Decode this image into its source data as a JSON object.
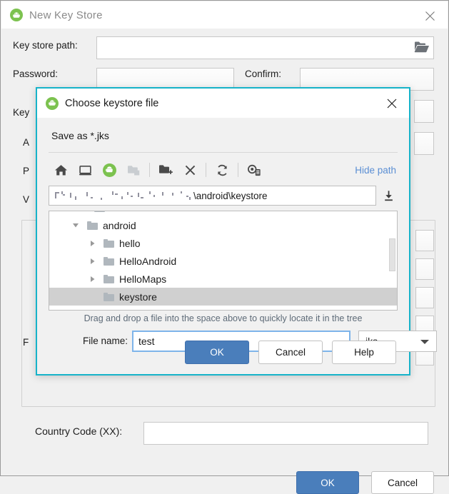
{
  "outer_window": {
    "title": "New Key Store",
    "icon": "android-studio-icon",
    "close_icon": "close-icon",
    "fields": [
      {
        "label": "Key store path:",
        "value": "",
        "browse_icon": "folder-open-icon"
      },
      {
        "label": "Password:",
        "value": ""
      },
      {
        "label": "Confirm:",
        "value": ""
      },
      {
        "label": "Key",
        "value": ""
      },
      {
        "label": "A",
        "value": ""
      },
      {
        "label": "P",
        "value": ""
      },
      {
        "label": "V",
        "value": ""
      },
      {
        "label": "F",
        "value": ""
      },
      {
        "label": "Country Code (XX):",
        "value": ""
      }
    ],
    "footer": {
      "ok_label": "OK",
      "cancel_label": "Cancel"
    }
  },
  "modal": {
    "title": "Choose keystore file",
    "icon": "android-studio-icon",
    "close_icon": "close-icon",
    "save_as": "Save as *.jks",
    "toolbar": {
      "items": [
        {
          "name": "home-icon",
          "tip": "Home"
        },
        {
          "name": "desktop-icon",
          "tip": "Desktop"
        },
        {
          "name": "project-icon",
          "tip": "Project"
        },
        {
          "name": "module-folder-icon",
          "tip": "Module",
          "disabled": true
        },
        {
          "name": "new-folder-icon",
          "tip": "New Folder"
        },
        {
          "name": "delete-icon",
          "tip": "Delete"
        },
        {
          "name": "refresh-icon",
          "tip": "Refresh"
        },
        {
          "name": "show-hidden-icon",
          "tip": "Show Hidden Files"
        }
      ],
      "hide_path_label": "Hide path"
    },
    "path": {
      "value_visible_suffix": "\\android\\keystore",
      "redacted_prefix": true,
      "download_icon": "download-icon"
    },
    "tree": {
      "nodes": [
        {
          "label": "android",
          "indent": 1,
          "twisty": "expanded",
          "selected": false
        },
        {
          "label": "hello",
          "indent": 2,
          "twisty": "collapsed",
          "selected": false
        },
        {
          "label": "HelloAndroid",
          "indent": 2,
          "twisty": "collapsed",
          "selected": false
        },
        {
          "label": "HelloMaps",
          "indent": 2,
          "twisty": "collapsed",
          "selected": false
        },
        {
          "label": "keystore",
          "indent": 2,
          "twisty": "none",
          "selected": true
        }
      ]
    },
    "hint": "Drag and drop a file into the space above to quickly locate it in the tree",
    "file_name": {
      "label": "File name:",
      "value": "test",
      "extension_selected": "jks",
      "extension_options": [
        "jks"
      ]
    },
    "footer": {
      "ok_label": "OK",
      "cancel_label": "Cancel",
      "help_label": "Help"
    }
  },
  "colors": {
    "accent_blue": "#4a7ebb",
    "modal_border": "#17b3c9",
    "link_blue": "#5b8fd4",
    "selection_gray": "#d0d0d0",
    "android_green": "#7cc24f",
    "focus_blue": "#7eb4ea"
  }
}
